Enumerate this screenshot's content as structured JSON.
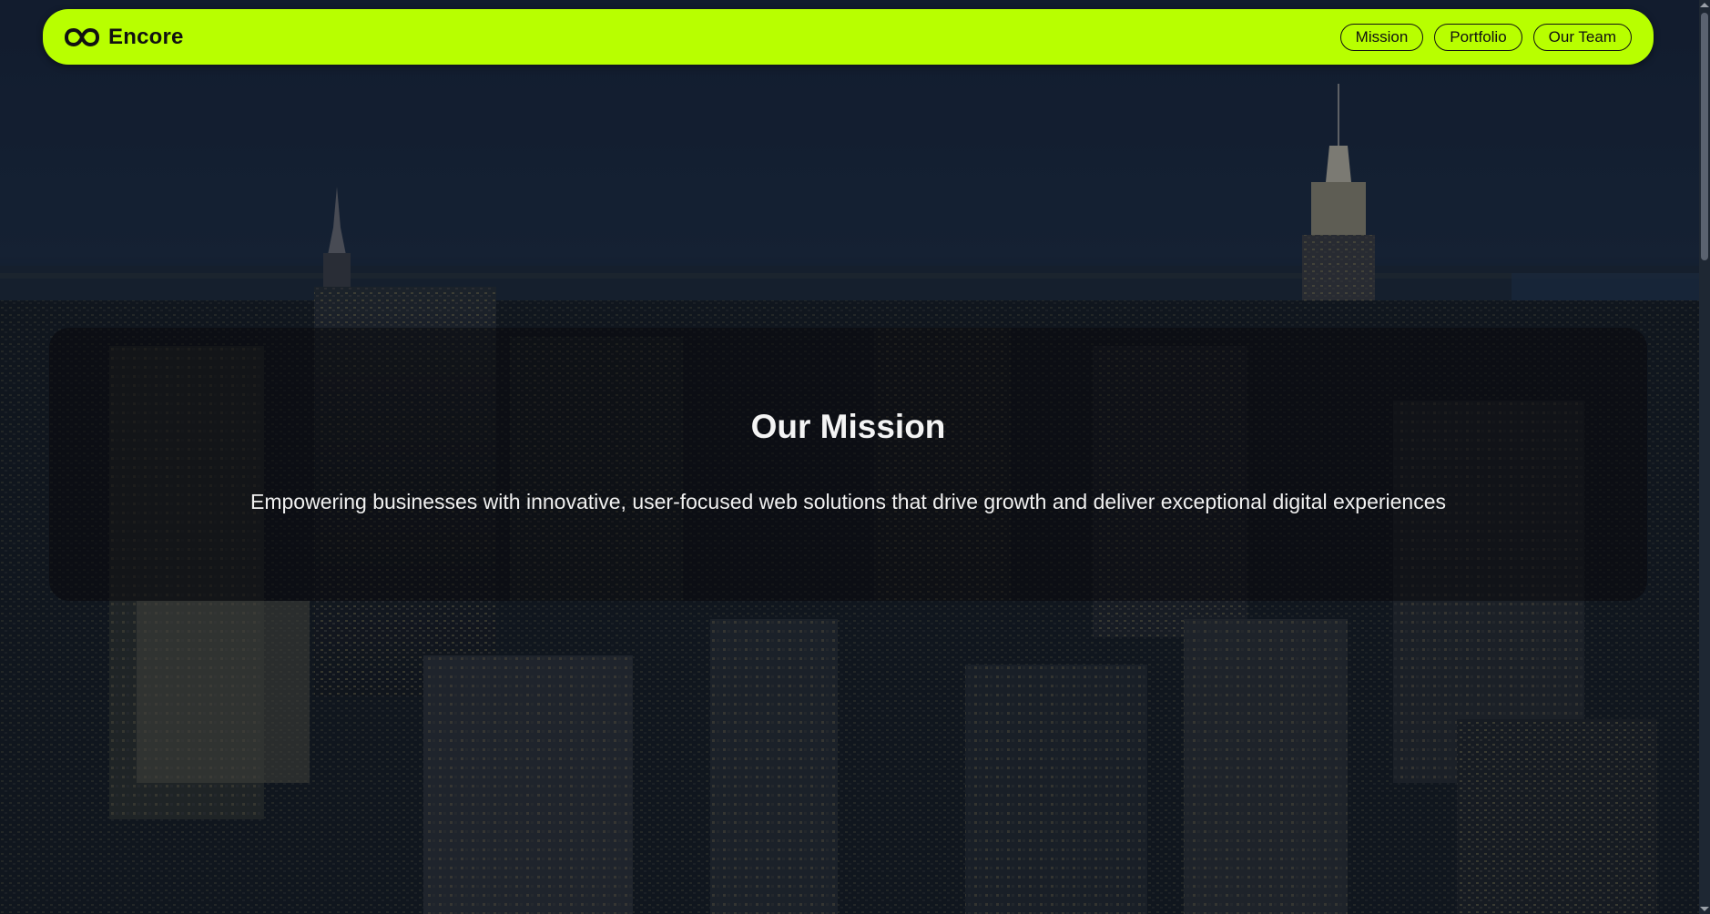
{
  "nav": {
    "brand_name": "Encore",
    "brand_icon": "infinity-icon",
    "links": [
      {
        "label": "Mission"
      },
      {
        "label": "Portfolio"
      },
      {
        "label": "Our Team"
      }
    ]
  },
  "hero": {
    "title": "Our Mission",
    "text": "Empowering businesses with innovative, user-focused web solutions that drive growth and deliver exceptional digital experiences"
  },
  "colors": {
    "accent": "#b8ff00",
    "background": "#0d1520",
    "text": "#f0f0f0"
  }
}
